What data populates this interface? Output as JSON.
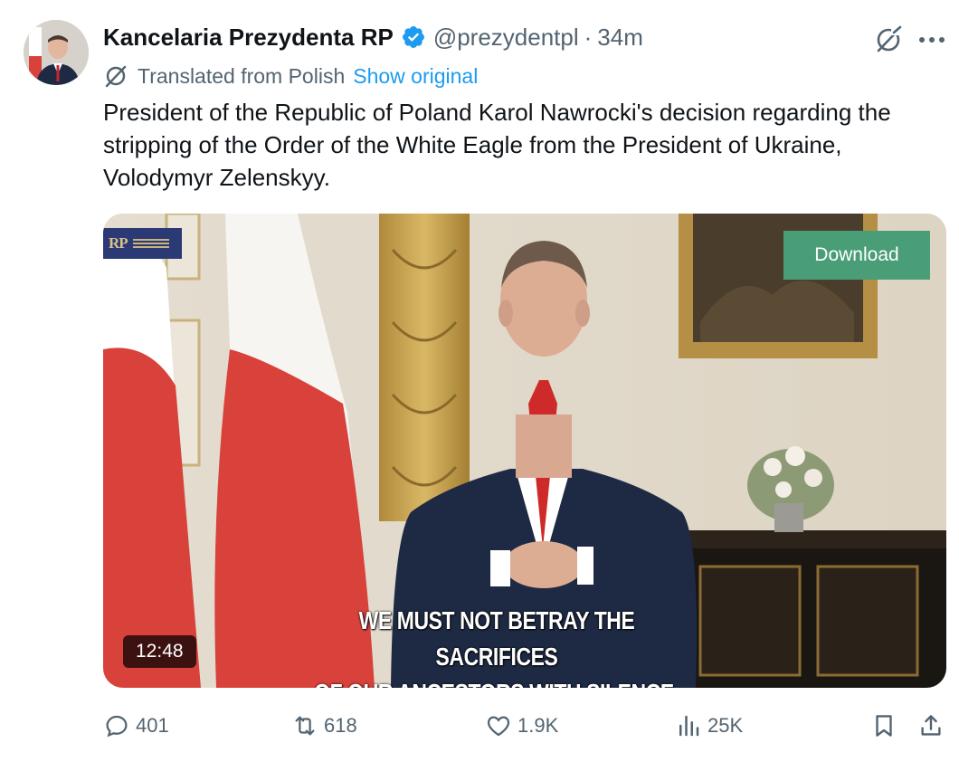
{
  "tweet": {
    "author": {
      "display_name": "Kancelaria Prezydenta RP",
      "handle": "@prezydentpl",
      "separator": "·",
      "time": "34m",
      "verified": true,
      "avatar_icon": "president-avatar"
    },
    "translation": {
      "label": "Translated from Polish",
      "show_original": "Show original"
    },
    "text": "President of the Republic of Poland Karol Nawrocki's decision regarding the stripping of the Order of the White Eagle from the President of Ukraine, Volodymyr Zelenskyy.",
    "media": {
      "download_label": "Download",
      "duration": "12:48",
      "caption_line1": "WE MUST NOT BETRAY THE SACRIFICES",
      "caption_line2": "OF OUR ANCESTORS WITH SILENCE.",
      "logo_mark": "RP"
    },
    "metrics": {
      "replies": "401",
      "reposts": "618",
      "likes": "1.9K",
      "views": "25K"
    }
  },
  "colors": {
    "accent": "#1d9bf0",
    "secondary_text": "#536471",
    "download_button": "#4a9e77",
    "flag_red": "#d8423a"
  },
  "icons": [
    "verified-badge-icon",
    "grok-icon",
    "more-icon",
    "translate-icon",
    "reply-icon",
    "repost-icon",
    "like-icon",
    "views-icon",
    "bookmark-icon",
    "share-icon"
  ]
}
